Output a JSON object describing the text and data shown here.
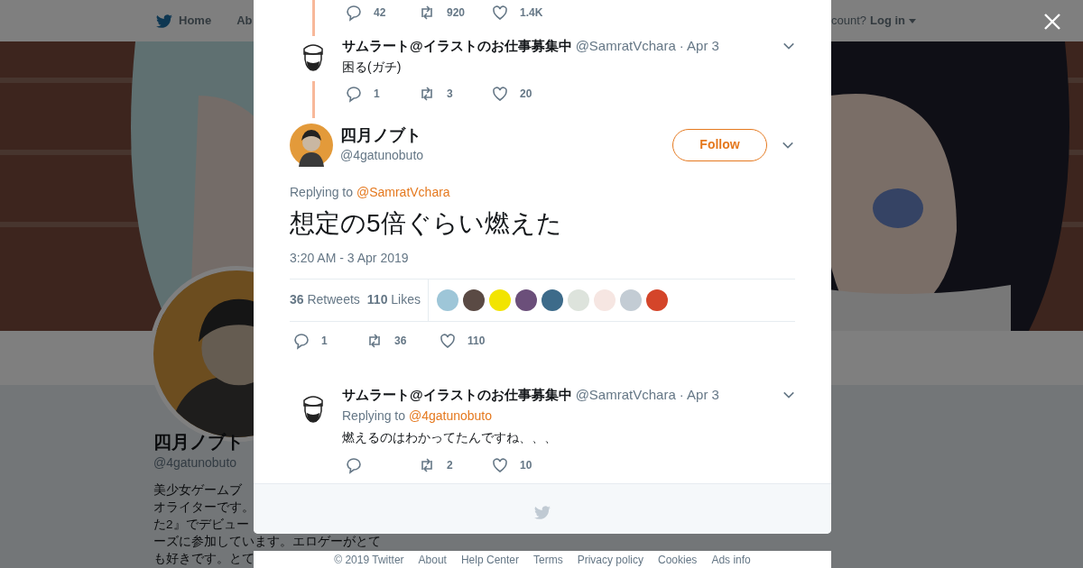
{
  "background_page": {
    "nav": {
      "items": [
        {
          "label": "Home"
        },
        {
          "label": "Ab"
        }
      ],
      "login_prompt": "count?",
      "login": "Log in"
    },
    "profile": {
      "name": "四月ノブト",
      "handle": "@4gatunobuto",
      "bio_lines": [
        "美少女ゲームブ",
        "オライターです。",
        "た2』でデビュー",
        "ーズに参加しています。エロゲーがとて",
        "も好きです。とて"
      ]
    }
  },
  "modal": {
    "previous_actions": {
      "reply": "42",
      "retweet": "920",
      "like": "1.4K"
    },
    "conversation_before": [
      {
        "author": "サムラート@イラストのお仕事募集中",
        "handle": "@SamratVchara",
        "date": "· Apr 3",
        "text": "困る(ガチ)",
        "actions": {
          "reply": "1",
          "retweet": "3",
          "like": "20"
        }
      }
    ],
    "main_tweet": {
      "author": "四月ノブト",
      "handle": "@4gatunobuto",
      "follow": "Follow",
      "replying_label": "Replying to",
      "replying_to": "@SamratVchara",
      "text": "想定の5倍ぐらい燃えた",
      "time": "3:20 AM - 3 Apr 2019",
      "stats": [
        "**36** Retweets",
        "**110** Likes"
      ],
      "likers": [
        {
          "color": "#9ec6d8"
        },
        {
          "color": "#5a4a44"
        },
        {
          "color": "#f2e400"
        },
        {
          "color": "#6b4f7a"
        },
        {
          "color": "#3d6b8a"
        },
        {
          "color": "#dde3dc"
        },
        {
          "color": "#f6e6e2"
        },
        {
          "color": "#c3ccd4"
        },
        {
          "color": "#d4452a"
        }
      ],
      "actions": {
        "reply": "1",
        "retweet": "36",
        "like": "110"
      }
    },
    "replies": [
      {
        "author": "サムラート@イラストのお仕事募集中",
        "handle": "@SamratVchara",
        "date": "· Apr 3",
        "replying_label": "Replying to",
        "replying_to": "@4gatunobuto",
        "text": "燃えるのはわかってたんですね、、、",
        "actions": {
          "retweet": "2",
          "like": "10"
        }
      }
    ]
  },
  "footer_links": [
    "© 2019 Twitter",
    "About",
    "Help Center",
    "Terms",
    "Privacy policy",
    "Cookies",
    "Ads info"
  ]
}
